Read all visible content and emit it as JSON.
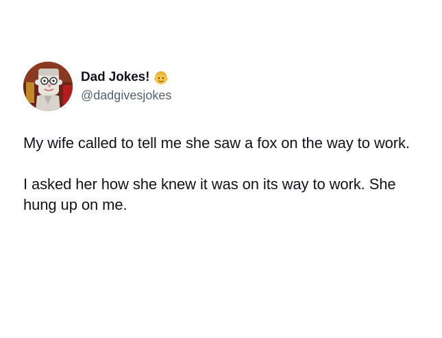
{
  "author": {
    "display_name": "Dad Jokes!",
    "handle": "@dadgivesjokes",
    "avatar_icon": "cartoon-dad-avatar-icon",
    "badge_icon": "man-face-emoji-icon"
  },
  "tweet": {
    "paragraphs": [
      "My wife called to tell me she saw a fox on the way to work.",
      "I asked her how she knew it was on its way to work. She hung up on me."
    ]
  },
  "colors": {
    "text": "#0f1419",
    "secondary_text": "#536471",
    "background": "#ffffff"
  }
}
